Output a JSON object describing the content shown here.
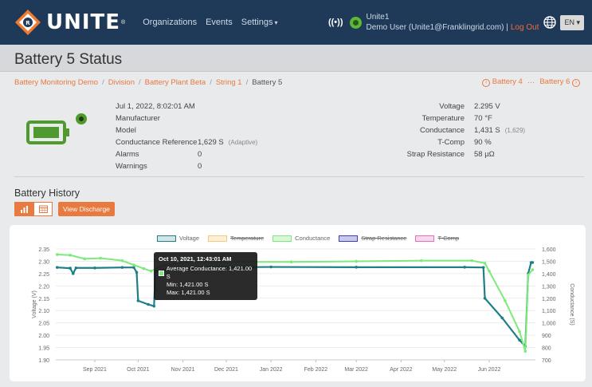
{
  "nav": {
    "brand": "UNITE",
    "brand_tm": "®",
    "links": [
      "Organizations",
      "Events",
      "Settings"
    ],
    "user_top": "Unite1",
    "user_line": "Demo User (Unite1@Franklingrid.com) |",
    "logout": "Log Out",
    "language": "EN",
    "colors": {
      "bar": "#1f3a58",
      "accent": "#f26b3a"
    }
  },
  "page_title": "Battery 5 Status",
  "breadcrumb": {
    "items": [
      "Battery Monitoring Demo",
      "Division",
      "Battery Plant Beta",
      "String 1"
    ],
    "current": "Battery 5",
    "prev": "Battery 4",
    "divider": "···",
    "next": "Battery 6"
  },
  "info": {
    "timestamp": "Jul 1, 2022, 8:02:01 AM",
    "manufacturer_label": "Manufacturer",
    "model_label": "Model",
    "cond_ref_label": "Conductance Reference",
    "cond_ref_value": "1,629 S",
    "cond_ref_note": "(Adaptive)",
    "alarms_label": "Alarms",
    "alarms_value": "0",
    "warnings_label": "Warnings",
    "warnings_value": "0",
    "battery_status_color": "#4e9a2f"
  },
  "readings": [
    {
      "label": "Voltage",
      "value": "2.295 V",
      "note": ""
    },
    {
      "label": "Temperature",
      "value": "70 °F",
      "note": ""
    },
    {
      "label": "Conductance",
      "value": "1,431 S",
      "note": "(1,629)"
    },
    {
      "label": "T-Comp",
      "value": "90 %",
      "note": ""
    },
    {
      "label": "Strap Resistance",
      "value": "58 µΩ",
      "note": ""
    }
  ],
  "history": {
    "title": "Battery History",
    "discharge_button": "View Discharge",
    "icons": [
      "bar-chart-icon",
      "calendar-icon"
    ]
  },
  "legend": [
    {
      "name": "Voltage",
      "color": "#1f7f86",
      "fill": "#cfe6e8",
      "hidden": false
    },
    {
      "name": "Temperature",
      "color": "#f5c979",
      "fill": "#fdf0d6",
      "hidden": true
    },
    {
      "name": "Conductance",
      "color": "#7dea7a",
      "fill": "#d8f7d6",
      "hidden": false
    },
    {
      "name": "Strap Resistance",
      "color": "#3e3ec8",
      "fill": "#c9c9f0",
      "hidden": true
    },
    {
      "name": "T-Comp",
      "color": "#e46fbf",
      "fill": "#f8d6ed",
      "hidden": true
    }
  ],
  "tooltip": {
    "title": "Oct 10, 2021, 12:43:01 AM",
    "line1": "Average Conductance: 1,421.00 S",
    "line2": "Min: 1,421.00 S",
    "line3": "Max: 1,421.00 S"
  },
  "chart_data": {
    "type": "line",
    "ylabel": "Voltage (V)",
    "y2label": "Conductance (S)",
    "yticks": [
      "2.35",
      "2.30",
      "2.25",
      "2.20",
      "2.15",
      "2.10",
      "2.05",
      "2.00",
      "1.95",
      "1.90"
    ],
    "y2ticks": [
      "1,600",
      "1,500",
      "1,400",
      "1,300",
      "1,200",
      "1,100",
      "1,000",
      "900",
      "800",
      "700"
    ],
    "xticks": [
      "Sep 2021",
      "Oct 2021",
      "Nov 2021",
      "Dec 2021",
      "Jan 2022",
      "Feb 2022",
      "Mar 2022",
      "Apr 2022",
      "May 2022",
      "Jun 2022"
    ],
    "ylim": [
      1.9,
      2.35
    ],
    "y2lim": [
      700,
      1600
    ],
    "series": [
      {
        "name": "Voltage",
        "color": "#1f7f86",
        "points": [
          [
            "2021-08-06",
            2.275
          ],
          [
            "2021-08-15",
            2.272
          ],
          [
            "2021-08-17",
            2.25
          ],
          [
            "2021-08-19",
            2.273
          ],
          [
            "2021-09-01",
            2.273
          ],
          [
            "2021-09-20",
            2.275
          ],
          [
            "2021-09-28",
            2.275
          ],
          [
            "2021-09-30",
            2.255
          ],
          [
            "2021-10-01",
            2.14
          ],
          [
            "2021-10-08",
            2.125
          ],
          [
            "2021-10-12",
            2.118
          ],
          [
            "2021-10-13",
            2.26
          ],
          [
            "2021-10-20",
            2.265
          ],
          [
            "2021-11-15",
            2.275
          ],
          [
            "2022-01-01",
            2.277
          ],
          [
            "2022-03-01",
            2.276
          ],
          [
            "2022-05-15",
            2.276
          ],
          [
            "2022-05-28",
            2.275
          ],
          [
            "2022-05-29",
            2.15
          ],
          [
            "2022-06-10",
            2.07
          ],
          [
            "2022-06-22",
            1.98
          ],
          [
            "2022-06-26",
            1.955
          ],
          [
            "2022-06-28",
            2.25
          ],
          [
            "2022-06-30",
            2.295
          ],
          [
            "2022-07-01",
            2.295
          ]
        ]
      },
      {
        "name": "Conductance",
        "color": "#7dea7a",
        "points": [
          [
            "2021-08-06",
            1555
          ],
          [
            "2021-08-15",
            1550
          ],
          [
            "2021-08-25",
            1520
          ],
          [
            "2021-09-05",
            1525
          ],
          [
            "2021-09-20",
            1505
          ],
          [
            "2021-09-28",
            1470
          ],
          [
            "2021-10-05",
            1440
          ],
          [
            "2021-10-10",
            1421
          ],
          [
            "2021-10-18",
            1465
          ],
          [
            "2021-11-01",
            1490
          ],
          [
            "2021-12-01",
            1495
          ],
          [
            "2022-01-15",
            1495
          ],
          [
            "2022-03-01",
            1500
          ],
          [
            "2022-04-15",
            1505
          ],
          [
            "2022-05-20",
            1505
          ],
          [
            "2022-05-29",
            1485
          ],
          [
            "2022-06-01",
            1420
          ],
          [
            "2022-06-12",
            1180
          ],
          [
            "2022-06-22",
            930
          ],
          [
            "2022-06-26",
            770
          ],
          [
            "2022-06-28",
            1390
          ],
          [
            "2022-07-01",
            1431
          ]
        ]
      }
    ]
  }
}
